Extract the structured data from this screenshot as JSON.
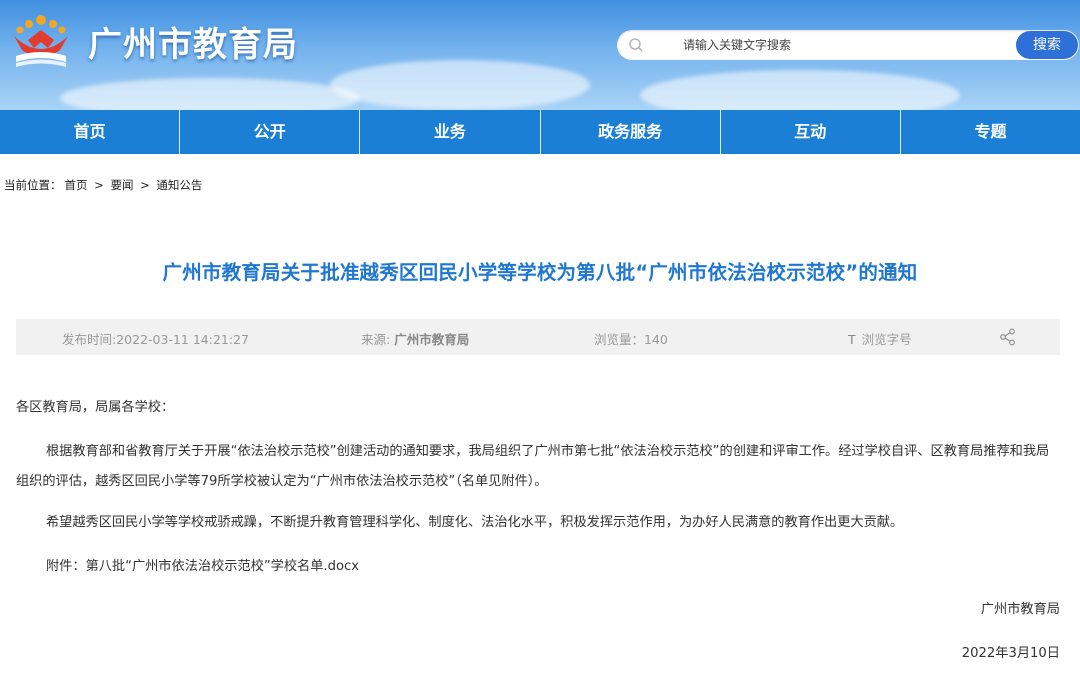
{
  "header": {
    "site_title": "广州市教育局",
    "search_placeholder": "请输入关键文字搜索",
    "search_button": "搜索"
  },
  "nav": {
    "items": [
      "首页",
      "公开",
      "业务",
      "政务服务",
      "互动",
      "专题"
    ]
  },
  "breadcrumb": {
    "prefix": "当前位置：",
    "items": [
      "首页",
      "要闻",
      "通知公告"
    ],
    "sep": ">"
  },
  "article": {
    "title": "广州市教育局关于批准越秀区回民小学等学校为第八批“广州市依法治校示范校”的通知",
    "meta": {
      "publish_label": "发布时间:",
      "publish_time": "2022-03-11 14:21:27",
      "source_label": "来源:",
      "source": "广州市教育局",
      "views_label": "浏览量：",
      "views": "140",
      "font_label": "浏览字号",
      "font_icon": "T"
    },
    "salutation": "各区教育局，局属各学校：",
    "body_p1": "根据教育部和省教育厅关于开展“依法治校示范校”创建活动的通知要求，我局组织了广州市第七批“依法治校示范校”的创建和评审工作。经过学校自评、区教育局推荐和我局组织的评估，越秀区回民小学等79所学校被认定为“广州市依法治校示范校”（名单见附件）。",
    "body_p2": "希望越秀区回民小学等学校戒骄戒躁，不断提升教育管理科学化、制度化、法治化水平，积极发挥示范作用，为办好人民满意的教育作出更大贡献。",
    "attachment_label": "附件：",
    "attachment": "第八批“广州市依法治校示范校”学校名单.docx",
    "signature": "广州市教育局",
    "date": "2022年3月10日"
  },
  "colors": {
    "nav_bg": "#1b7fd6",
    "title_blue": "#1f77d0",
    "search_button": "#2f6fd8"
  }
}
